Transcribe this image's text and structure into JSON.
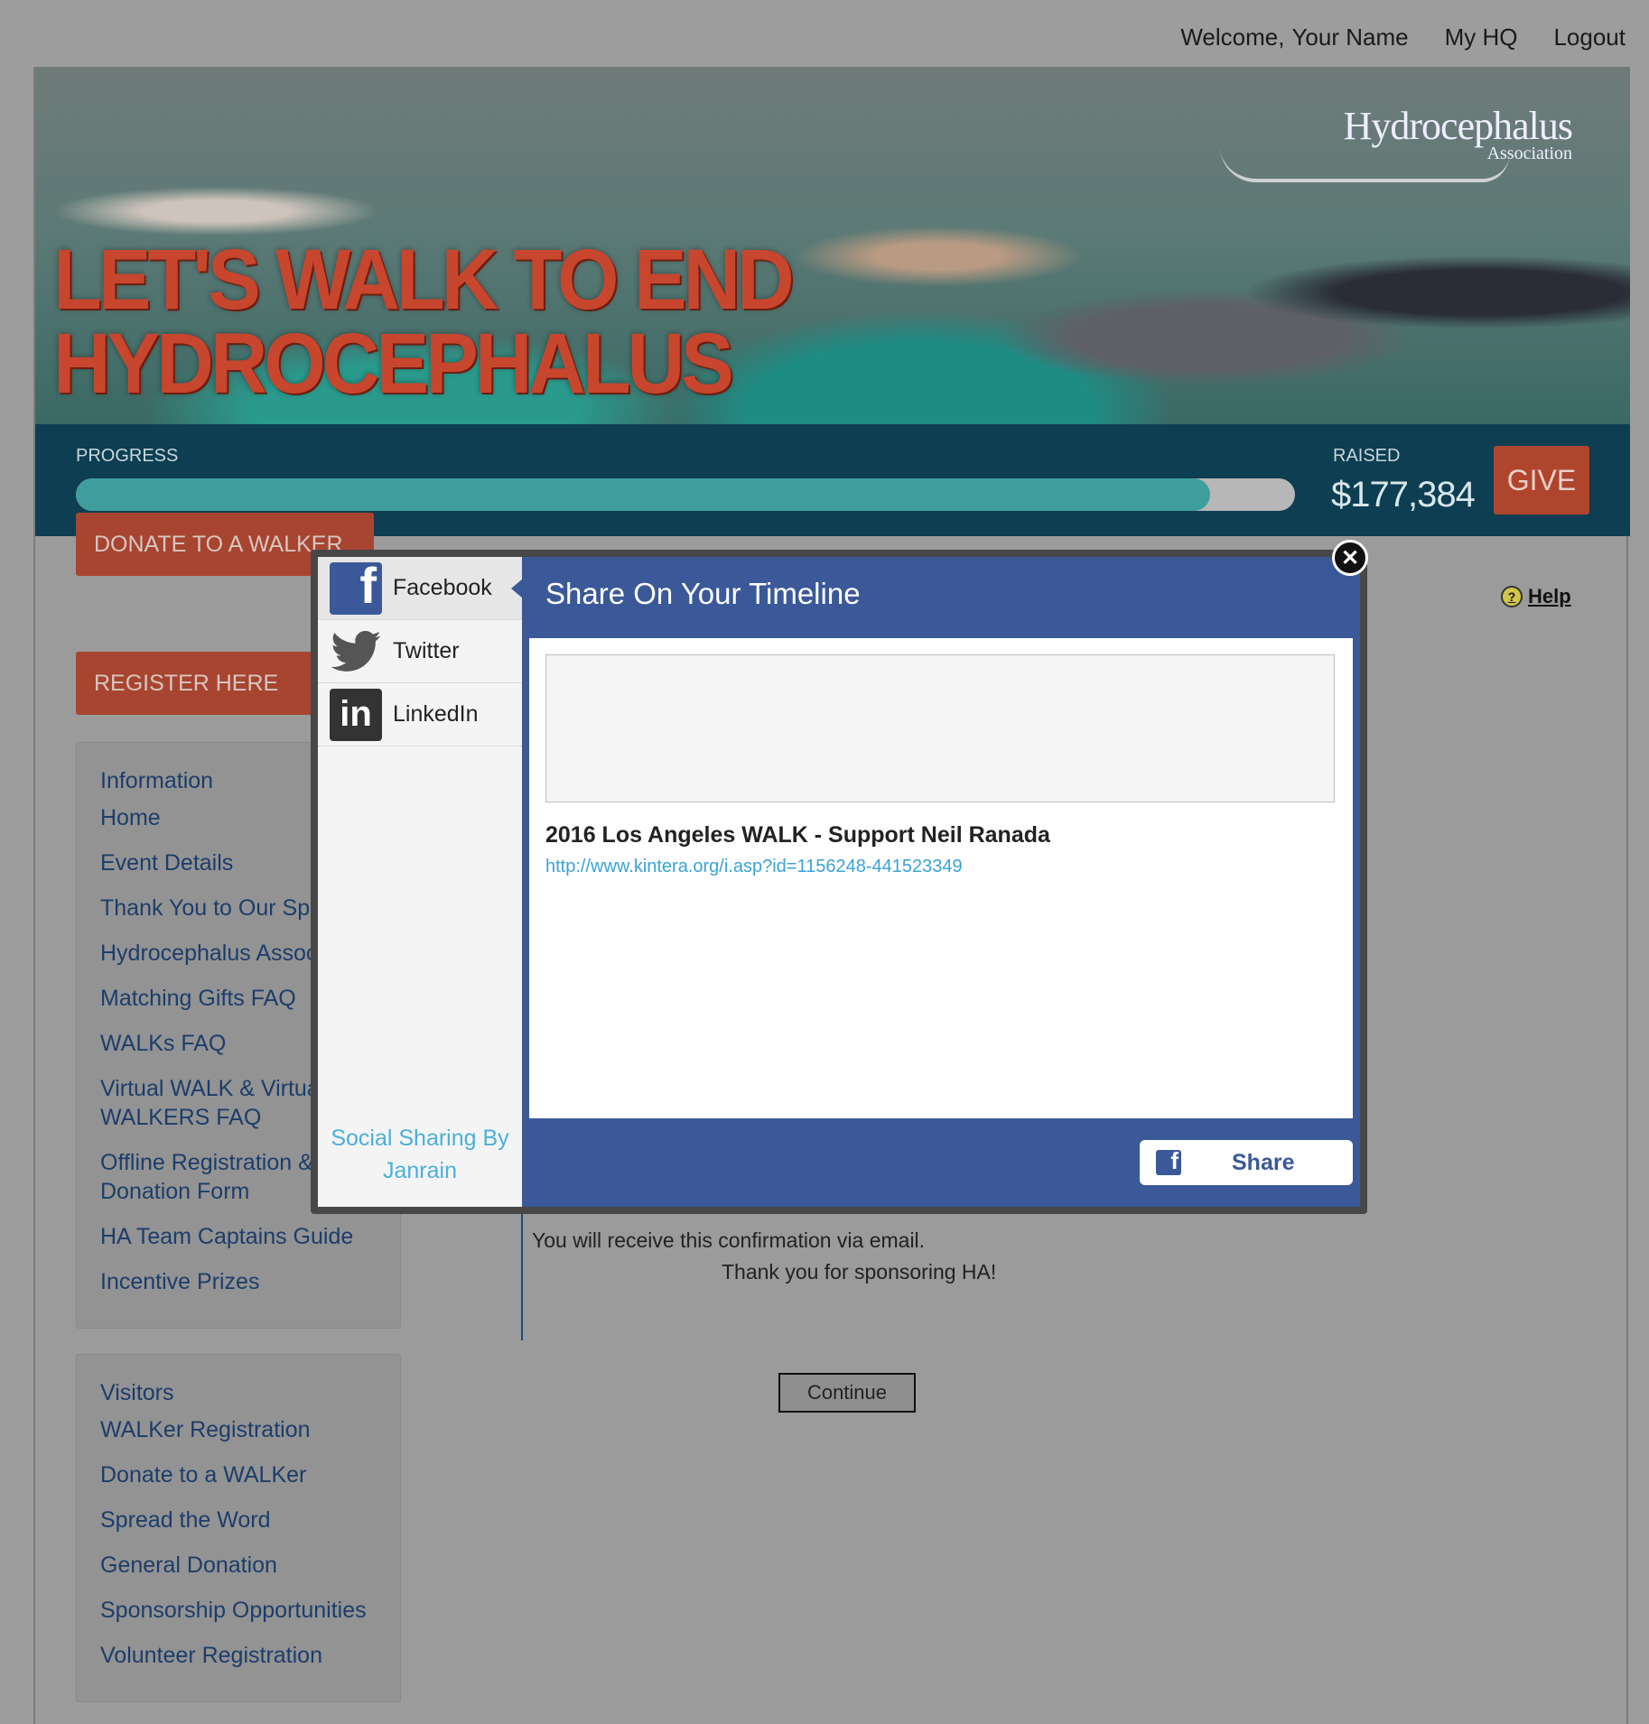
{
  "topbar": {
    "welcome": "Welcome,",
    "user_name": "Your Name",
    "my_hq": "My HQ",
    "logout": "Logout"
  },
  "banner": {
    "title_line1": "LET'S WALK TO END",
    "title_line2": "HYDROCEPHALUS",
    "logo_name": "Hydrocephalus",
    "logo_sub": "Association"
  },
  "progress": {
    "label": "PROGRESS",
    "fraction": 0.93,
    "raised_label": "RAISED",
    "raised_value": "$177,384",
    "give_label": "GIVE"
  },
  "left": {
    "donate_label": "DONATE TO A WALKER",
    "register_label": "REGISTER HERE",
    "info_heading": "Information",
    "info_items": [
      "Home",
      "Event Details",
      "Thank You to Our Sponsors",
      "Hydrocephalus Association",
      "Matching Gifts FAQ",
      "WALKs FAQ",
      "Virtual WALK & Virtual WALKERS FAQ",
      "Offline Registration & Donation Form",
      "HA Team Captains Guide",
      "Incentive Prizes"
    ],
    "visitors_heading": "Visitors",
    "visitor_items": [
      "WALKer Registration",
      "Donate to a WALKer",
      "Spread the Word",
      "General Donation",
      "Sponsorship Opportunities",
      "Volunteer Registration"
    ]
  },
  "help_label": "Help",
  "content": {
    "confirm1": "You will receive this confirmation via email.",
    "confirm2": "Thank you for sponsoring HA!",
    "continue_label": "Continue"
  },
  "modal": {
    "tabs": [
      "Facebook",
      "Twitter",
      "LinkedIn"
    ],
    "powered_by_line1": "Social Sharing By",
    "powered_by_line2": "Janrain",
    "panel_title": "Share On Your Timeline",
    "message_placeholder": "",
    "share_title": "2016 Los Angeles WALK - Support Neil Ranada",
    "share_link": "http://www.kintera.org/i.asp?id=1156248-441523349",
    "share_button": "Share"
  }
}
